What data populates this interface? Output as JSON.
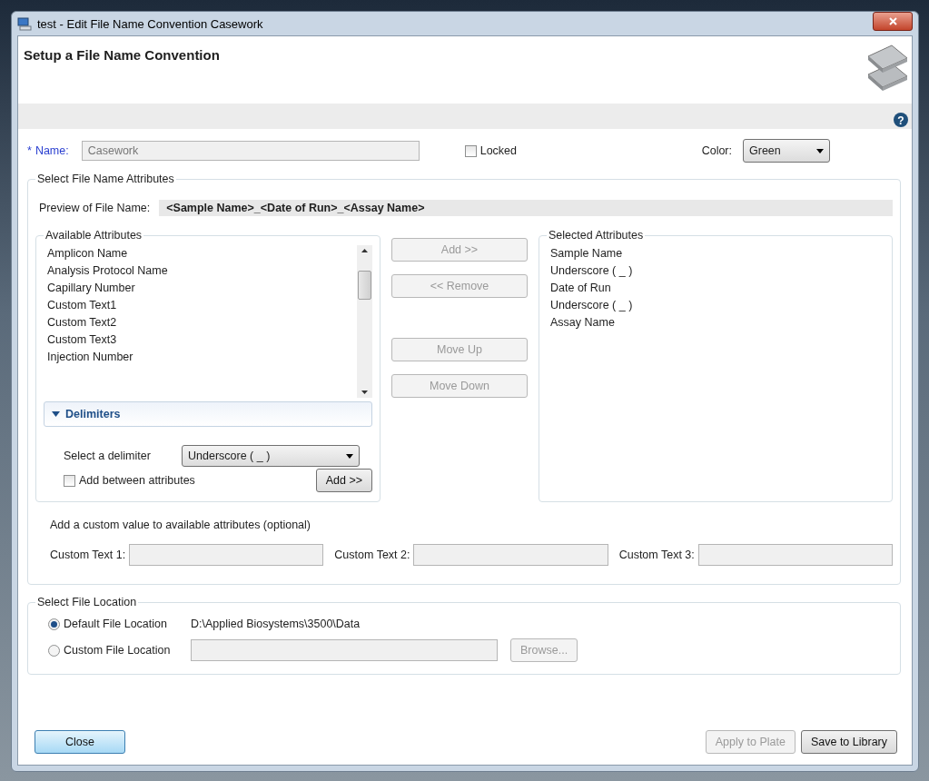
{
  "window": {
    "title": "test - Edit File Name Convention Casework"
  },
  "header": {
    "title": "Setup a File Name Convention",
    "help": "?"
  },
  "name_field": {
    "required_mark": "*",
    "label": "Name:",
    "value": "Casework",
    "disabled": true
  },
  "locked": {
    "label": "Locked",
    "checked": false
  },
  "color": {
    "label": "Color:",
    "value": "Green"
  },
  "attributes_section": {
    "title": "Select File Name Attributes",
    "preview_label": "Preview of File Name:",
    "preview": "<Sample Name>_<Date of Run>_<Assay Name>",
    "available": {
      "title": "Available Attributes",
      "items": [
        "Amplicon Name",
        "Analysis Protocol Name",
        "Capillary Number",
        "Custom Text1",
        "Custom Text2",
        "Custom Text3",
        "Injection Number"
      ]
    },
    "delimiters": {
      "title": "Delimiters",
      "expanded": true,
      "select_label": "Select a delimiter",
      "value": "Underscore ( _ )",
      "add_between": {
        "label": "Add between attributes",
        "checked": false
      },
      "add_button": {
        "label": "Add >>",
        "disabled": false
      }
    },
    "actions": [
      {
        "label": "Add >>",
        "disabled": true
      },
      {
        "label": "<< Remove",
        "disabled": true
      },
      {
        "label": "Move Up",
        "disabled": true
      },
      {
        "label": "Move Down",
        "disabled": true
      }
    ],
    "selected": {
      "title": "Selected Attributes",
      "items": [
        "Sample Name",
        "Underscore ( _ )",
        "Date of Run",
        "Underscore ( _ )",
        "Assay Name"
      ]
    },
    "custom_hint": "Add a custom value to available attributes (optional)",
    "custom_fields": [
      {
        "label": "Custom Text 1:",
        "disabled": true
      },
      {
        "label": "Custom Text 2:",
        "disabled": true
      },
      {
        "label": "Custom Text 3:",
        "disabled": true
      }
    ]
  },
  "location_section": {
    "title": "Select File Location",
    "options": [
      {
        "kind": "path",
        "label": "Default File Location",
        "selected": true,
        "path": "D:\\Applied Biosystems\\3500\\Data"
      },
      {
        "kind": "field",
        "label": "Custom File Location",
        "selected": false,
        "disabled": true
      }
    ],
    "browse": {
      "label": "Browse...",
      "disabled": true
    }
  },
  "footer": {
    "left": [
      {
        "label": "Close",
        "default": true,
        "disabled": false
      }
    ],
    "right": [
      {
        "label": "Apply to Plate",
        "default": false,
        "disabled": true
      },
      {
        "label": "Save to Library",
        "default": false,
        "disabled": false
      }
    ]
  }
}
